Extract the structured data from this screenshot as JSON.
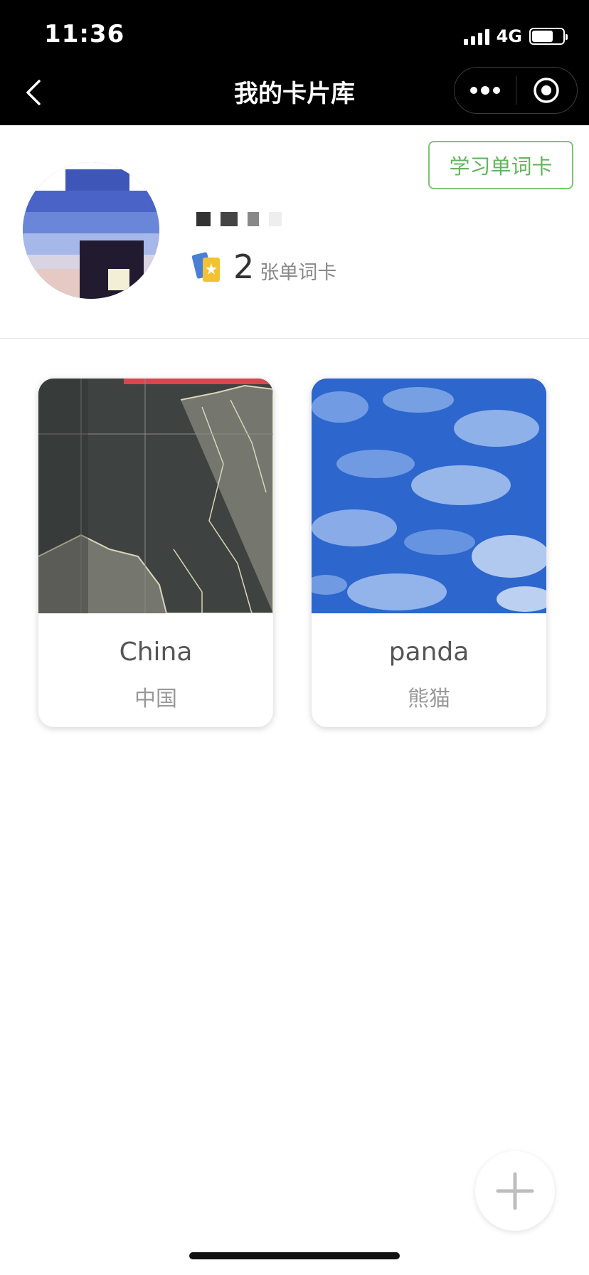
{
  "status_bar": {
    "time": "11:36",
    "network": "4G",
    "battery_level": 0.7
  },
  "nav": {
    "title": "我的卡片库",
    "back_icon": "chevron-left-icon",
    "more_icon": "more-dots-icon",
    "close_icon": "target-circle-icon"
  },
  "profile": {
    "avatar_icon": "avatar-pixelated",
    "card_count": "2",
    "card_count_label": "张单词卡",
    "study_button_label": "学习单词卡",
    "accent_color": "#64b45e"
  },
  "cards": [
    {
      "word": "China",
      "meaning": "中国",
      "image": "map-photo"
    },
    {
      "word": "panda",
      "meaning": "熊猫",
      "image": "sky-photo"
    }
  ],
  "fab": {
    "icon": "plus-icon"
  }
}
